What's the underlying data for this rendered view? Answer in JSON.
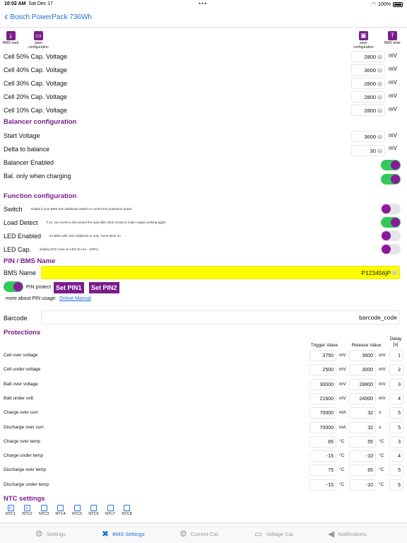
{
  "status": {
    "time": "10:02 AM",
    "date": "Sat Dec 17",
    "battery": "100%"
  },
  "nav": {
    "back_label": "Bosch PowerPack 736Wh"
  },
  "toolbar": {
    "bms_read": "BMS read",
    "open_config": "open\nconfiguration",
    "save_config": "save\nconfiguration",
    "bms_write": "BMS write"
  },
  "cap_rows": [
    {
      "label": "Cell 50% Cap. Voltage",
      "value": "2800",
      "unit": "mV"
    },
    {
      "label": "Cell 40% Cap. Voltage",
      "value": "3000",
      "unit": "mV"
    },
    {
      "label": "Cell 30% Cap. Voltage",
      "value": "2800",
      "unit": "mV"
    },
    {
      "label": "Cell 20% Cap. Voltage",
      "value": "2800",
      "unit": "mV"
    },
    {
      "label": "Cell 10% Cap. Voltage",
      "value": "2800",
      "unit": "mV"
    }
  ],
  "balancer": {
    "title": "Balancer configuration",
    "start_voltage_label": "Start Voltage",
    "start_voltage": "3600",
    "start_unit": "mV",
    "delta_label": "Delta to balance",
    "delta": "30",
    "delta_unit": "mV",
    "enabled_label": "Balancer Enabled",
    "enabled": true,
    "charging_label": "Bal. only when charging",
    "charging": true
  },
  "function": {
    "title": "Function configuration",
    "items": [
      {
        "label": "Switch",
        "hint": "enable if your BMS has additional Switch to control the protection board",
        "on": false
      },
      {
        "label": "Load Detect",
        "hint": "if on, you need to disconnect the load after short circuit to make output working again",
        "on": true
      },
      {
        "label": "LED Enabled",
        "hint": "for BMS with LED soldered on only. Turns them on",
        "on": false
      },
      {
        "label": "LED Cap.",
        "hint": "display SOC level on LED (5 Led - 100%)",
        "on": false
      }
    ]
  },
  "pin": {
    "title": "PIN / BMS Name",
    "bms_name_label": "BMS Name",
    "bms_name": "P123456jP",
    "protect_label": "PIN protect",
    "protect_on": true,
    "set_pin1": "Set PIN1",
    "set_pin2": "Set PIN2",
    "more_label": "more about PIN usage:",
    "manual_link": "Online Manual",
    "barcode_label": "Barcode",
    "barcode": "barcode_code"
  },
  "protections": {
    "title": "Protections",
    "headers": {
      "trigger": "Trigger Value",
      "release": "Release Value",
      "delay": "Delay\n[s]"
    },
    "rows": [
      {
        "label": "Cell over voltage",
        "trigger": "3750",
        "tunit": "mV",
        "release": "3600",
        "runit": "mV",
        "delay": "1"
      },
      {
        "label": "Cell under voltage",
        "trigger": "2500",
        "tunit": "mV",
        "release": "3000",
        "runit": "mV",
        "delay": "2"
      },
      {
        "label": "Batt over voltage",
        "trigger": "30000",
        "tunit": "mV",
        "release": "28800",
        "runit": "mV",
        "delay": "3"
      },
      {
        "label": "Batt under volt.",
        "trigger": "21600",
        "tunit": "mV",
        "release": "24000",
        "runit": "mV",
        "delay": "4"
      },
      {
        "label": "Charge over curr.",
        "trigger": "70000",
        "tunit": "mA",
        "release": "32",
        "runit": "s",
        "delay": "5"
      },
      {
        "label": "Discharge over curr.",
        "trigger": "70000",
        "tunit": "mA",
        "release": "32",
        "runit": "s",
        "delay": "5"
      },
      {
        "label": "Charge over temp",
        "trigger": "65",
        "tunit": "°C",
        "release": "55",
        "runit": "°C",
        "delay": "3"
      },
      {
        "label": "Charge under temp",
        "trigger": "-15",
        "tunit": "°C",
        "release": "-10",
        "runit": "°C",
        "delay": "4"
      },
      {
        "label": "Discharge over temp",
        "trigger": "75",
        "tunit": "°C",
        "release": "65",
        "runit": "°C",
        "delay": "5"
      },
      {
        "label": "Discharge under temp",
        "trigger": "-15",
        "tunit": "°C",
        "release": "-10",
        "runit": "°C",
        "delay": "6"
      }
    ]
  },
  "ntc": {
    "title": "NTC settings",
    "items": [
      {
        "label": "NTC1",
        "checked": true
      },
      {
        "label": "NTC2",
        "checked": true
      },
      {
        "label": "NTC3",
        "checked": false
      },
      {
        "label": "NTC4",
        "checked": false
      },
      {
        "label": "NTC5",
        "checked": false
      },
      {
        "label": "NTC6",
        "checked": false
      },
      {
        "label": "NTC7",
        "checked": false
      },
      {
        "label": "NTC8",
        "checked": false
      }
    ]
  },
  "tabs": [
    {
      "label": "Settings",
      "icon": "gear-icon",
      "active": false
    },
    {
      "label": "BMS Settings",
      "icon": "tools-icon",
      "active": true
    },
    {
      "label": "Current Cal.",
      "icon": "gear-icon",
      "active": false
    },
    {
      "label": "Voltage Cal.",
      "icon": "battery-icon",
      "active": false
    },
    {
      "label": "Notifications",
      "icon": "megaphone-icon",
      "active": false
    }
  ],
  "colors": {
    "accent": "#7a1d8a",
    "link": "#1e6fd9",
    "toggle_on": "#34c759",
    "highlight": "#ffff00"
  }
}
